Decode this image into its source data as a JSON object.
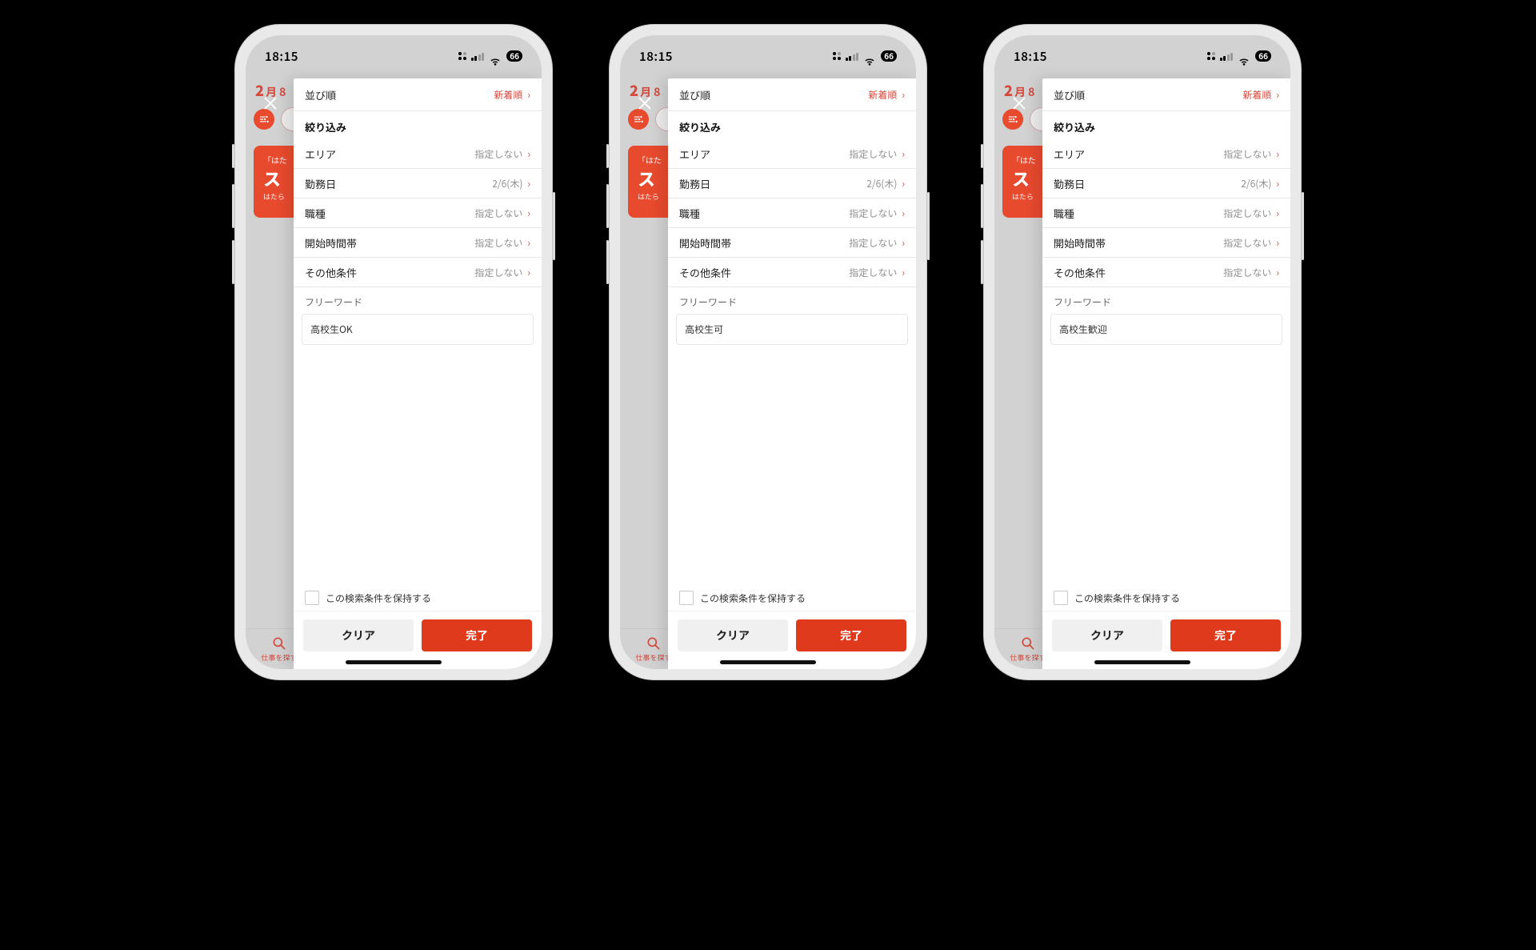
{
  "status": {
    "time": "18:15",
    "battery": "66"
  },
  "bg": {
    "date_num": "2",
    "date_suffix": "月 8",
    "banner_line1": "「はた",
    "banner_line2": "ス",
    "banner_line3": "はたら",
    "tab_label": "仕事を探す"
  },
  "sheet": {
    "sort_label": "並び順",
    "sort_value": "新着順",
    "filter_heading": "絞り込み",
    "rows": [
      {
        "label": "エリア",
        "value": "指定しない"
      },
      {
        "label": "勤務日",
        "value": "2/6(木)"
      },
      {
        "label": "職種",
        "value": "指定しない"
      },
      {
        "label": "開始時間帯",
        "value": "指定しない"
      },
      {
        "label": "その他条件",
        "value": "指定しない"
      }
    ],
    "freeword_label": "フリーワード",
    "save_label": "この検索条件を保持する",
    "clear_label": "クリア",
    "done_label": "完了"
  },
  "phones": [
    {
      "freeword_value": "高校生OK"
    },
    {
      "freeword_value": "高校生可"
    },
    {
      "freeword_value": "高校生歓迎"
    }
  ]
}
